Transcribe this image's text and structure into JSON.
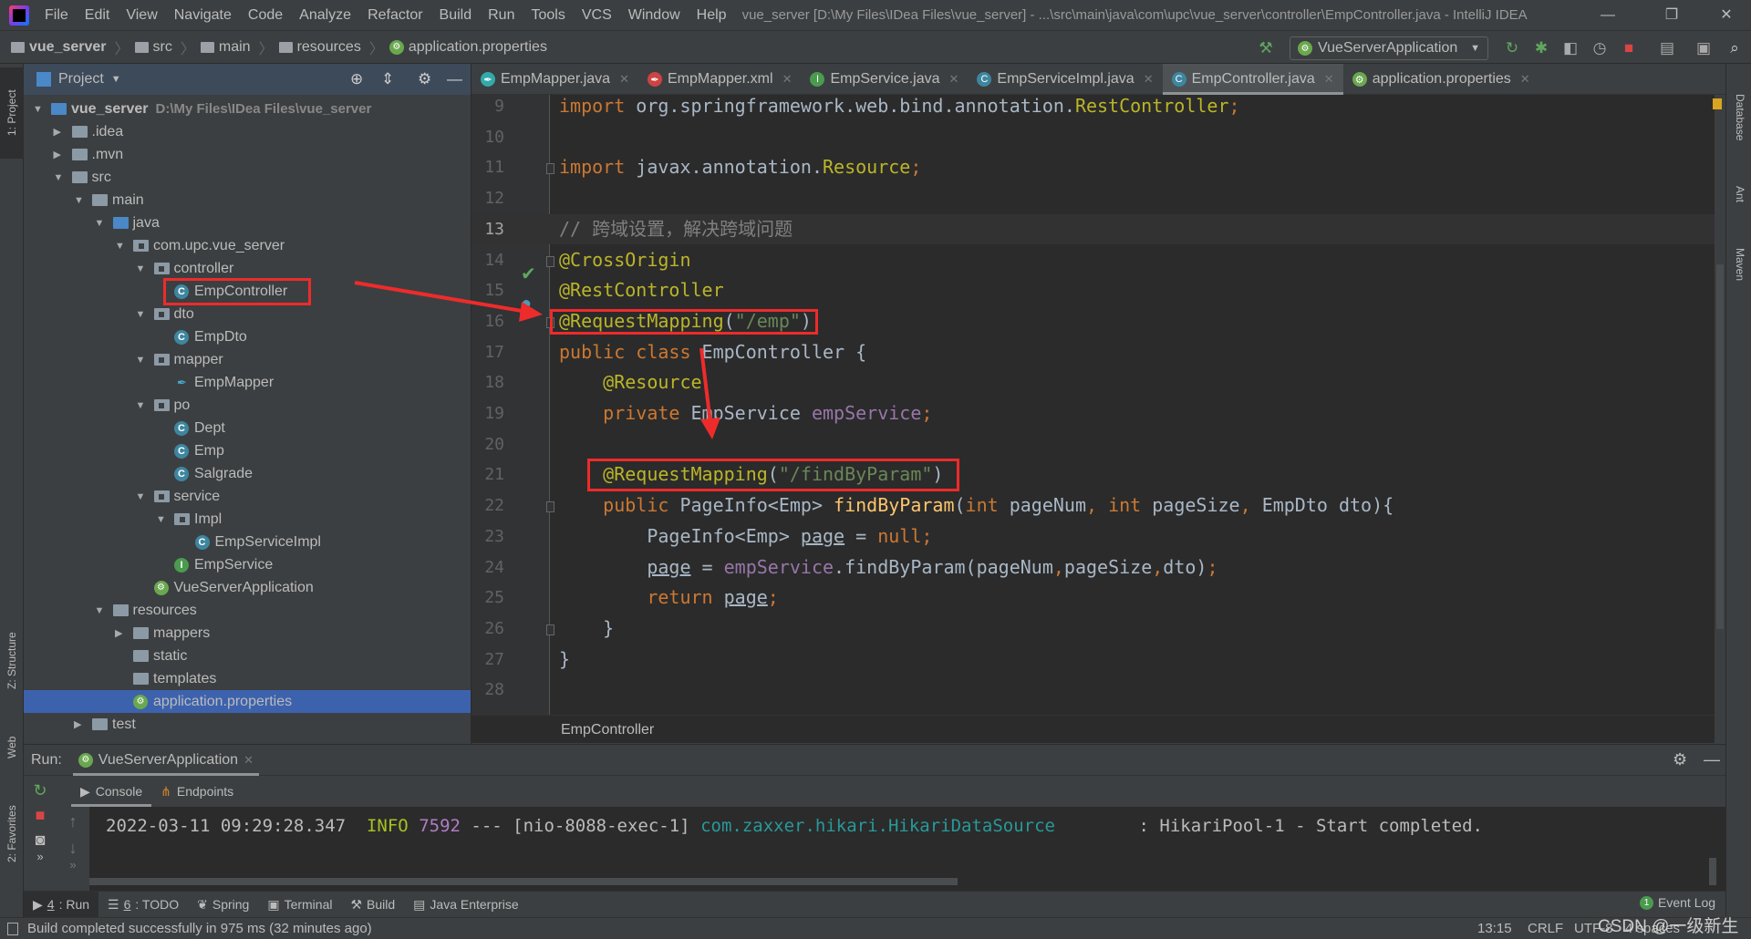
{
  "menu": [
    "File",
    "Edit",
    "View",
    "Navigate",
    "Code",
    "Analyze",
    "Refactor",
    "Build",
    "Run",
    "Tools",
    "VCS",
    "Window",
    "Help"
  ],
  "window_title": "vue_server [D:\\My Files\\IDea Files\\vue_server] - ...\\src\\main\\java\\com\\upc\\vue_server\\controller\\EmpController.java - IntelliJ IDEA",
  "breadcrumb": [
    "vue_server",
    "src",
    "main",
    "resources",
    "application.properties"
  ],
  "run_config": "VueServerApplication",
  "left_strip": {
    "project": "1: Project",
    "structure": "Z: Structure",
    "web": "Web",
    "favorites": "2: Favorites"
  },
  "right_strip": {
    "database": "Database",
    "ant": "Ant",
    "maven": "Maven"
  },
  "project_panel": {
    "title": "Project",
    "tree": [
      {
        "d": 0,
        "a": "open",
        "i": "srcf",
        "label": "vue_server",
        "extra": "D:\\My Files\\IDea Files\\vue_server",
        "bold": true
      },
      {
        "d": 1,
        "a": "closed",
        "i": "folder",
        "label": ".idea"
      },
      {
        "d": 1,
        "a": "closed",
        "i": "folder",
        "label": ".mvn"
      },
      {
        "d": 1,
        "a": "open",
        "i": "folder",
        "label": "src"
      },
      {
        "d": 2,
        "a": "open",
        "i": "folder",
        "label": "main"
      },
      {
        "d": 3,
        "a": "open",
        "i": "srcf",
        "label": "java"
      },
      {
        "d": 4,
        "a": "open",
        "i": "pkg",
        "label": "com.upc.vue_server"
      },
      {
        "d": 5,
        "a": "open",
        "i": "pkg",
        "label": "controller"
      },
      {
        "d": 6,
        "a": "",
        "i": "cls",
        "label": "EmpController"
      },
      {
        "d": 5,
        "a": "open",
        "i": "pkg",
        "label": "dto"
      },
      {
        "d": 6,
        "a": "",
        "i": "cls",
        "label": "EmpDto"
      },
      {
        "d": 5,
        "a": "open",
        "i": "pkg",
        "label": "mapper"
      },
      {
        "d": 6,
        "a": "",
        "i": "mapper",
        "label": "EmpMapper"
      },
      {
        "d": 5,
        "a": "open",
        "i": "pkg",
        "label": "po"
      },
      {
        "d": 6,
        "a": "",
        "i": "cls",
        "label": "Dept"
      },
      {
        "d": 6,
        "a": "",
        "i": "cls",
        "label": "Emp"
      },
      {
        "d": 6,
        "a": "",
        "i": "cls",
        "label": "Salgrade"
      },
      {
        "d": 5,
        "a": "open",
        "i": "pkg",
        "label": "service"
      },
      {
        "d": 6,
        "a": "open",
        "i": "pkg",
        "label": "Impl"
      },
      {
        "d": 7,
        "a": "",
        "i": "cls",
        "label": "EmpServiceImpl"
      },
      {
        "d": 6,
        "a": "",
        "i": "intf",
        "label": "EmpService"
      },
      {
        "d": 5,
        "a": "",
        "i": "spring",
        "label": "VueServerApplication"
      },
      {
        "d": 3,
        "a": "open",
        "i": "folder",
        "label": "resources"
      },
      {
        "d": 4,
        "a": "closed",
        "i": "folder",
        "label": "mappers"
      },
      {
        "d": 4,
        "a": "",
        "i": "folder",
        "label": "static"
      },
      {
        "d": 4,
        "a": "",
        "i": "folder",
        "label": "templates"
      },
      {
        "d": 4,
        "a": "",
        "i": "spring",
        "label": "application.properties",
        "selected": true
      },
      {
        "d": 2,
        "a": "closed",
        "i": "folder",
        "label": "test"
      }
    ]
  },
  "editor_tabs": [
    {
      "label": "EmpMapper.java",
      "icon": "mapper"
    },
    {
      "label": "EmpMapper.xml",
      "icon": "xml"
    },
    {
      "label": "EmpService.java",
      "icon": "interface"
    },
    {
      "label": "EmpServiceImpl.java",
      "icon": "class"
    },
    {
      "label": "EmpController.java",
      "icon": "class",
      "active": true
    },
    {
      "label": "application.properties",
      "icon": "spring"
    }
  ],
  "code": [
    {
      "n": "9",
      "t": [
        [
          "kw",
          "import "
        ],
        [
          "df",
          "org.springframework.web.bind.annotation."
        ],
        [
          "cn",
          "RestController"
        ],
        [
          "kw",
          ";"
        ]
      ]
    },
    {
      "n": "10",
      "t": []
    },
    {
      "n": "11",
      "t": [
        [
          "kw",
          "import "
        ],
        [
          "df",
          "javax.annotation."
        ],
        [
          "cn",
          "Resource"
        ],
        [
          "kw",
          ";"
        ]
      ]
    },
    {
      "n": "12",
      "t": []
    },
    {
      "n": "13",
      "cur": true,
      "t": [
        [
          "cm",
          "// 跨域设置，解决跨域问题"
        ]
      ]
    },
    {
      "n": "14",
      "t": [
        [
          "an",
          "@CrossOrigin"
        ]
      ]
    },
    {
      "n": "15",
      "t": [
        [
          "an",
          "@RestController"
        ]
      ]
    },
    {
      "n": "16",
      "t": [
        [
          "an",
          "@RequestMapping"
        ],
        [
          "df",
          "("
        ],
        [
          "st",
          "\"/emp\""
        ],
        [
          "df",
          ")"
        ]
      ]
    },
    {
      "n": "17",
      "t": [
        [
          "kw",
          "public class "
        ],
        [
          "df",
          "EmpController {"
        ]
      ]
    },
    {
      "n": "18",
      "t": [
        [
          "df",
          "    "
        ],
        [
          "an",
          "@Resource"
        ]
      ]
    },
    {
      "n": "19",
      "t": [
        [
          "df",
          "    "
        ],
        [
          "kw",
          "private "
        ],
        [
          "df",
          "EmpService "
        ],
        [
          "fd",
          "empService"
        ],
        [
          "kw",
          ";"
        ]
      ]
    },
    {
      "n": "20",
      "t": []
    },
    {
      "n": "21",
      "t": [
        [
          "df",
          "    "
        ],
        [
          "an",
          "@RequestMapping"
        ],
        [
          "df",
          "("
        ],
        [
          "st",
          "\"/findByParam\""
        ],
        [
          "df",
          ")"
        ]
      ]
    },
    {
      "n": "22",
      "t": [
        [
          "df",
          "    "
        ],
        [
          "kw",
          "public "
        ],
        [
          "df",
          "PageInfo<Emp> "
        ],
        [
          "mt",
          "findByParam"
        ],
        [
          "df",
          "("
        ],
        [
          "kw",
          "int "
        ],
        [
          "df",
          "pageNum"
        ],
        [
          "kw",
          ", int "
        ],
        [
          "df",
          "pageSize"
        ],
        [
          "kw",
          ", "
        ],
        [
          "df",
          "EmpDto dto){"
        ]
      ]
    },
    {
      "n": "23",
      "t": [
        [
          "df",
          "        PageInfo<Emp> "
        ],
        [
          "df u",
          "page"
        ],
        [
          "df",
          " = "
        ],
        [
          "kw",
          "null;"
        ]
      ]
    },
    {
      "n": "24",
      "t": [
        [
          "df",
          "        "
        ],
        [
          "df u",
          "page"
        ],
        [
          "df",
          " = "
        ],
        [
          "fd",
          "empService"
        ],
        [
          "df",
          ".findByParam(pageNum"
        ],
        [
          "kw",
          ","
        ],
        [
          "df",
          "pageSize"
        ],
        [
          "kw",
          ","
        ],
        [
          "df",
          "dto)"
        ],
        [
          "kw",
          ";"
        ]
      ]
    },
    {
      "n": "25",
      "t": [
        [
          "df",
          "        "
        ],
        [
          "kw",
          "return "
        ],
        [
          "df u",
          "page"
        ],
        [
          "kw",
          ";"
        ]
      ]
    },
    {
      "n": "26",
      "t": [
        [
          "df",
          "    }"
        ]
      ]
    },
    {
      "n": "27",
      "t": [
        [
          "df",
          "}"
        ]
      ]
    },
    {
      "n": "28",
      "t": []
    }
  ],
  "editor_breadcrumb": "EmpController",
  "run": {
    "label": "Run:",
    "tab": "VueServerApplication",
    "console_tabs": [
      "Console",
      "Endpoints"
    ],
    "log": [
      [
        "df",
        "2022-03-11 09:29:28.347  "
      ],
      [
        "info",
        "INFO "
      ],
      [
        "pid",
        "7592"
      ],
      [
        "df",
        " --- [nio-8088-exec-1] "
      ],
      [
        "logger",
        "com.zaxxer.hikari.HikariDataSource      "
      ],
      [
        "df",
        "  : HikariPool-1 - Start completed."
      ]
    ]
  },
  "bottom_tabs": [
    {
      "num": "4",
      "label": ": Run",
      "active": true
    },
    {
      "num": "6",
      "label": ": TODO"
    },
    {
      "label": "Spring"
    },
    {
      "label": "Terminal"
    },
    {
      "label": "Build"
    },
    {
      "label": "Java Enterprise"
    }
  ],
  "event_log": {
    "count": "1",
    "label": "Event Log"
  },
  "status": {
    "message": "Build completed successfully in 975 ms (32 minutes ago)",
    "position": "13:15",
    "line_sep": "CRLF",
    "encoding": "UTF-8",
    "indent": "4 spaces"
  },
  "watermark": "CSDN @一级新生",
  "colors": {
    "annotation_box": "#ee2b2b",
    "selection": "#3d62ad",
    "editor_bg": "#2b2b2b"
  }
}
